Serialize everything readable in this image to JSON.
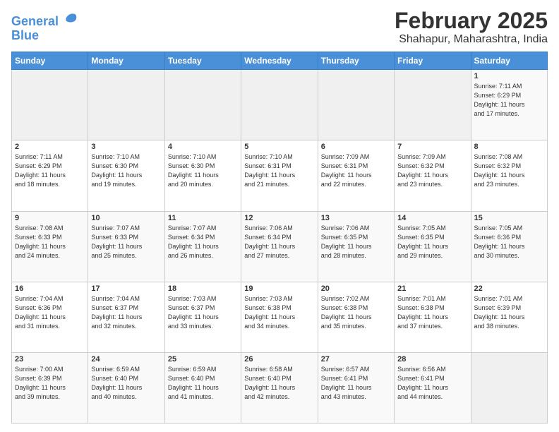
{
  "header": {
    "logo_line1": "General",
    "logo_line2": "Blue",
    "main_title": "February 2025",
    "sub_title": "Shahapur, Maharashtra, India"
  },
  "calendar": {
    "days_of_week": [
      "Sunday",
      "Monday",
      "Tuesday",
      "Wednesday",
      "Thursday",
      "Friday",
      "Saturday"
    ],
    "weeks": [
      [
        {
          "day": "",
          "info": ""
        },
        {
          "day": "",
          "info": ""
        },
        {
          "day": "",
          "info": ""
        },
        {
          "day": "",
          "info": ""
        },
        {
          "day": "",
          "info": ""
        },
        {
          "day": "",
          "info": ""
        },
        {
          "day": "1",
          "info": "Sunrise: 7:11 AM\nSunset: 6:29 PM\nDaylight: 11 hours\nand 17 minutes."
        }
      ],
      [
        {
          "day": "2",
          "info": "Sunrise: 7:11 AM\nSunset: 6:29 PM\nDaylight: 11 hours\nand 18 minutes."
        },
        {
          "day": "3",
          "info": "Sunrise: 7:10 AM\nSunset: 6:30 PM\nDaylight: 11 hours\nand 19 minutes."
        },
        {
          "day": "4",
          "info": "Sunrise: 7:10 AM\nSunset: 6:30 PM\nDaylight: 11 hours\nand 20 minutes."
        },
        {
          "day": "5",
          "info": "Sunrise: 7:10 AM\nSunset: 6:31 PM\nDaylight: 11 hours\nand 21 minutes."
        },
        {
          "day": "6",
          "info": "Sunrise: 7:09 AM\nSunset: 6:31 PM\nDaylight: 11 hours\nand 22 minutes."
        },
        {
          "day": "7",
          "info": "Sunrise: 7:09 AM\nSunset: 6:32 PM\nDaylight: 11 hours\nand 23 minutes."
        },
        {
          "day": "8",
          "info": "Sunrise: 7:08 AM\nSunset: 6:32 PM\nDaylight: 11 hours\nand 23 minutes."
        }
      ],
      [
        {
          "day": "9",
          "info": "Sunrise: 7:08 AM\nSunset: 6:33 PM\nDaylight: 11 hours\nand 24 minutes."
        },
        {
          "day": "10",
          "info": "Sunrise: 7:07 AM\nSunset: 6:33 PM\nDaylight: 11 hours\nand 25 minutes."
        },
        {
          "day": "11",
          "info": "Sunrise: 7:07 AM\nSunset: 6:34 PM\nDaylight: 11 hours\nand 26 minutes."
        },
        {
          "day": "12",
          "info": "Sunrise: 7:06 AM\nSunset: 6:34 PM\nDaylight: 11 hours\nand 27 minutes."
        },
        {
          "day": "13",
          "info": "Sunrise: 7:06 AM\nSunset: 6:35 PM\nDaylight: 11 hours\nand 28 minutes."
        },
        {
          "day": "14",
          "info": "Sunrise: 7:05 AM\nSunset: 6:35 PM\nDaylight: 11 hours\nand 29 minutes."
        },
        {
          "day": "15",
          "info": "Sunrise: 7:05 AM\nSunset: 6:36 PM\nDaylight: 11 hours\nand 30 minutes."
        }
      ],
      [
        {
          "day": "16",
          "info": "Sunrise: 7:04 AM\nSunset: 6:36 PM\nDaylight: 11 hours\nand 31 minutes."
        },
        {
          "day": "17",
          "info": "Sunrise: 7:04 AM\nSunset: 6:37 PM\nDaylight: 11 hours\nand 32 minutes."
        },
        {
          "day": "18",
          "info": "Sunrise: 7:03 AM\nSunset: 6:37 PM\nDaylight: 11 hours\nand 33 minutes."
        },
        {
          "day": "19",
          "info": "Sunrise: 7:03 AM\nSunset: 6:38 PM\nDaylight: 11 hours\nand 34 minutes."
        },
        {
          "day": "20",
          "info": "Sunrise: 7:02 AM\nSunset: 6:38 PM\nDaylight: 11 hours\nand 35 minutes."
        },
        {
          "day": "21",
          "info": "Sunrise: 7:01 AM\nSunset: 6:38 PM\nDaylight: 11 hours\nand 37 minutes."
        },
        {
          "day": "22",
          "info": "Sunrise: 7:01 AM\nSunset: 6:39 PM\nDaylight: 11 hours\nand 38 minutes."
        }
      ],
      [
        {
          "day": "23",
          "info": "Sunrise: 7:00 AM\nSunset: 6:39 PM\nDaylight: 11 hours\nand 39 minutes."
        },
        {
          "day": "24",
          "info": "Sunrise: 6:59 AM\nSunset: 6:40 PM\nDaylight: 11 hours\nand 40 minutes."
        },
        {
          "day": "25",
          "info": "Sunrise: 6:59 AM\nSunset: 6:40 PM\nDaylight: 11 hours\nand 41 minutes."
        },
        {
          "day": "26",
          "info": "Sunrise: 6:58 AM\nSunset: 6:40 PM\nDaylight: 11 hours\nand 42 minutes."
        },
        {
          "day": "27",
          "info": "Sunrise: 6:57 AM\nSunset: 6:41 PM\nDaylight: 11 hours\nand 43 minutes."
        },
        {
          "day": "28",
          "info": "Sunrise: 6:56 AM\nSunset: 6:41 PM\nDaylight: 11 hours\nand 44 minutes."
        },
        {
          "day": "",
          "info": ""
        }
      ]
    ]
  }
}
